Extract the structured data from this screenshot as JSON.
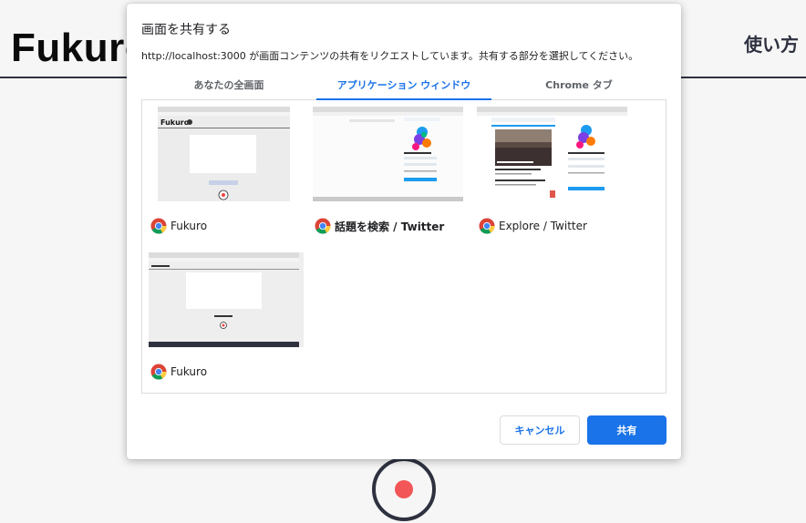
{
  "background_page": {
    "logo": "Fukuro",
    "howto_label": "使い方"
  },
  "dialog": {
    "title": "画面を共有する",
    "description": "http://localhost:3000 が画面コンテンツの共有をリクエストしています。共有する部分を選択してください。",
    "tabs": [
      {
        "label": "あなたの全画面",
        "active": false
      },
      {
        "label": "アプリケーション ウィンドウ",
        "active": true
      },
      {
        "label": "Chrome タブ",
        "active": false
      }
    ],
    "windows": [
      {
        "title": "Fukuro",
        "bold": false,
        "icon": "chrome-icon"
      },
      {
        "title": "話題を検索 / Twitter",
        "bold": true,
        "icon": "chrome-icon"
      },
      {
        "title": "Explore / Twitter",
        "bold": false,
        "icon": "chrome-icon"
      },
      {
        "title": "Fukuro",
        "bold": false,
        "icon": "chrome-icon"
      }
    ],
    "cancel_label": "キャンセル",
    "share_label": "共有"
  },
  "colors": {
    "accent": "#1a73e8",
    "record": "#f25656",
    "dark": "#2e3240"
  }
}
